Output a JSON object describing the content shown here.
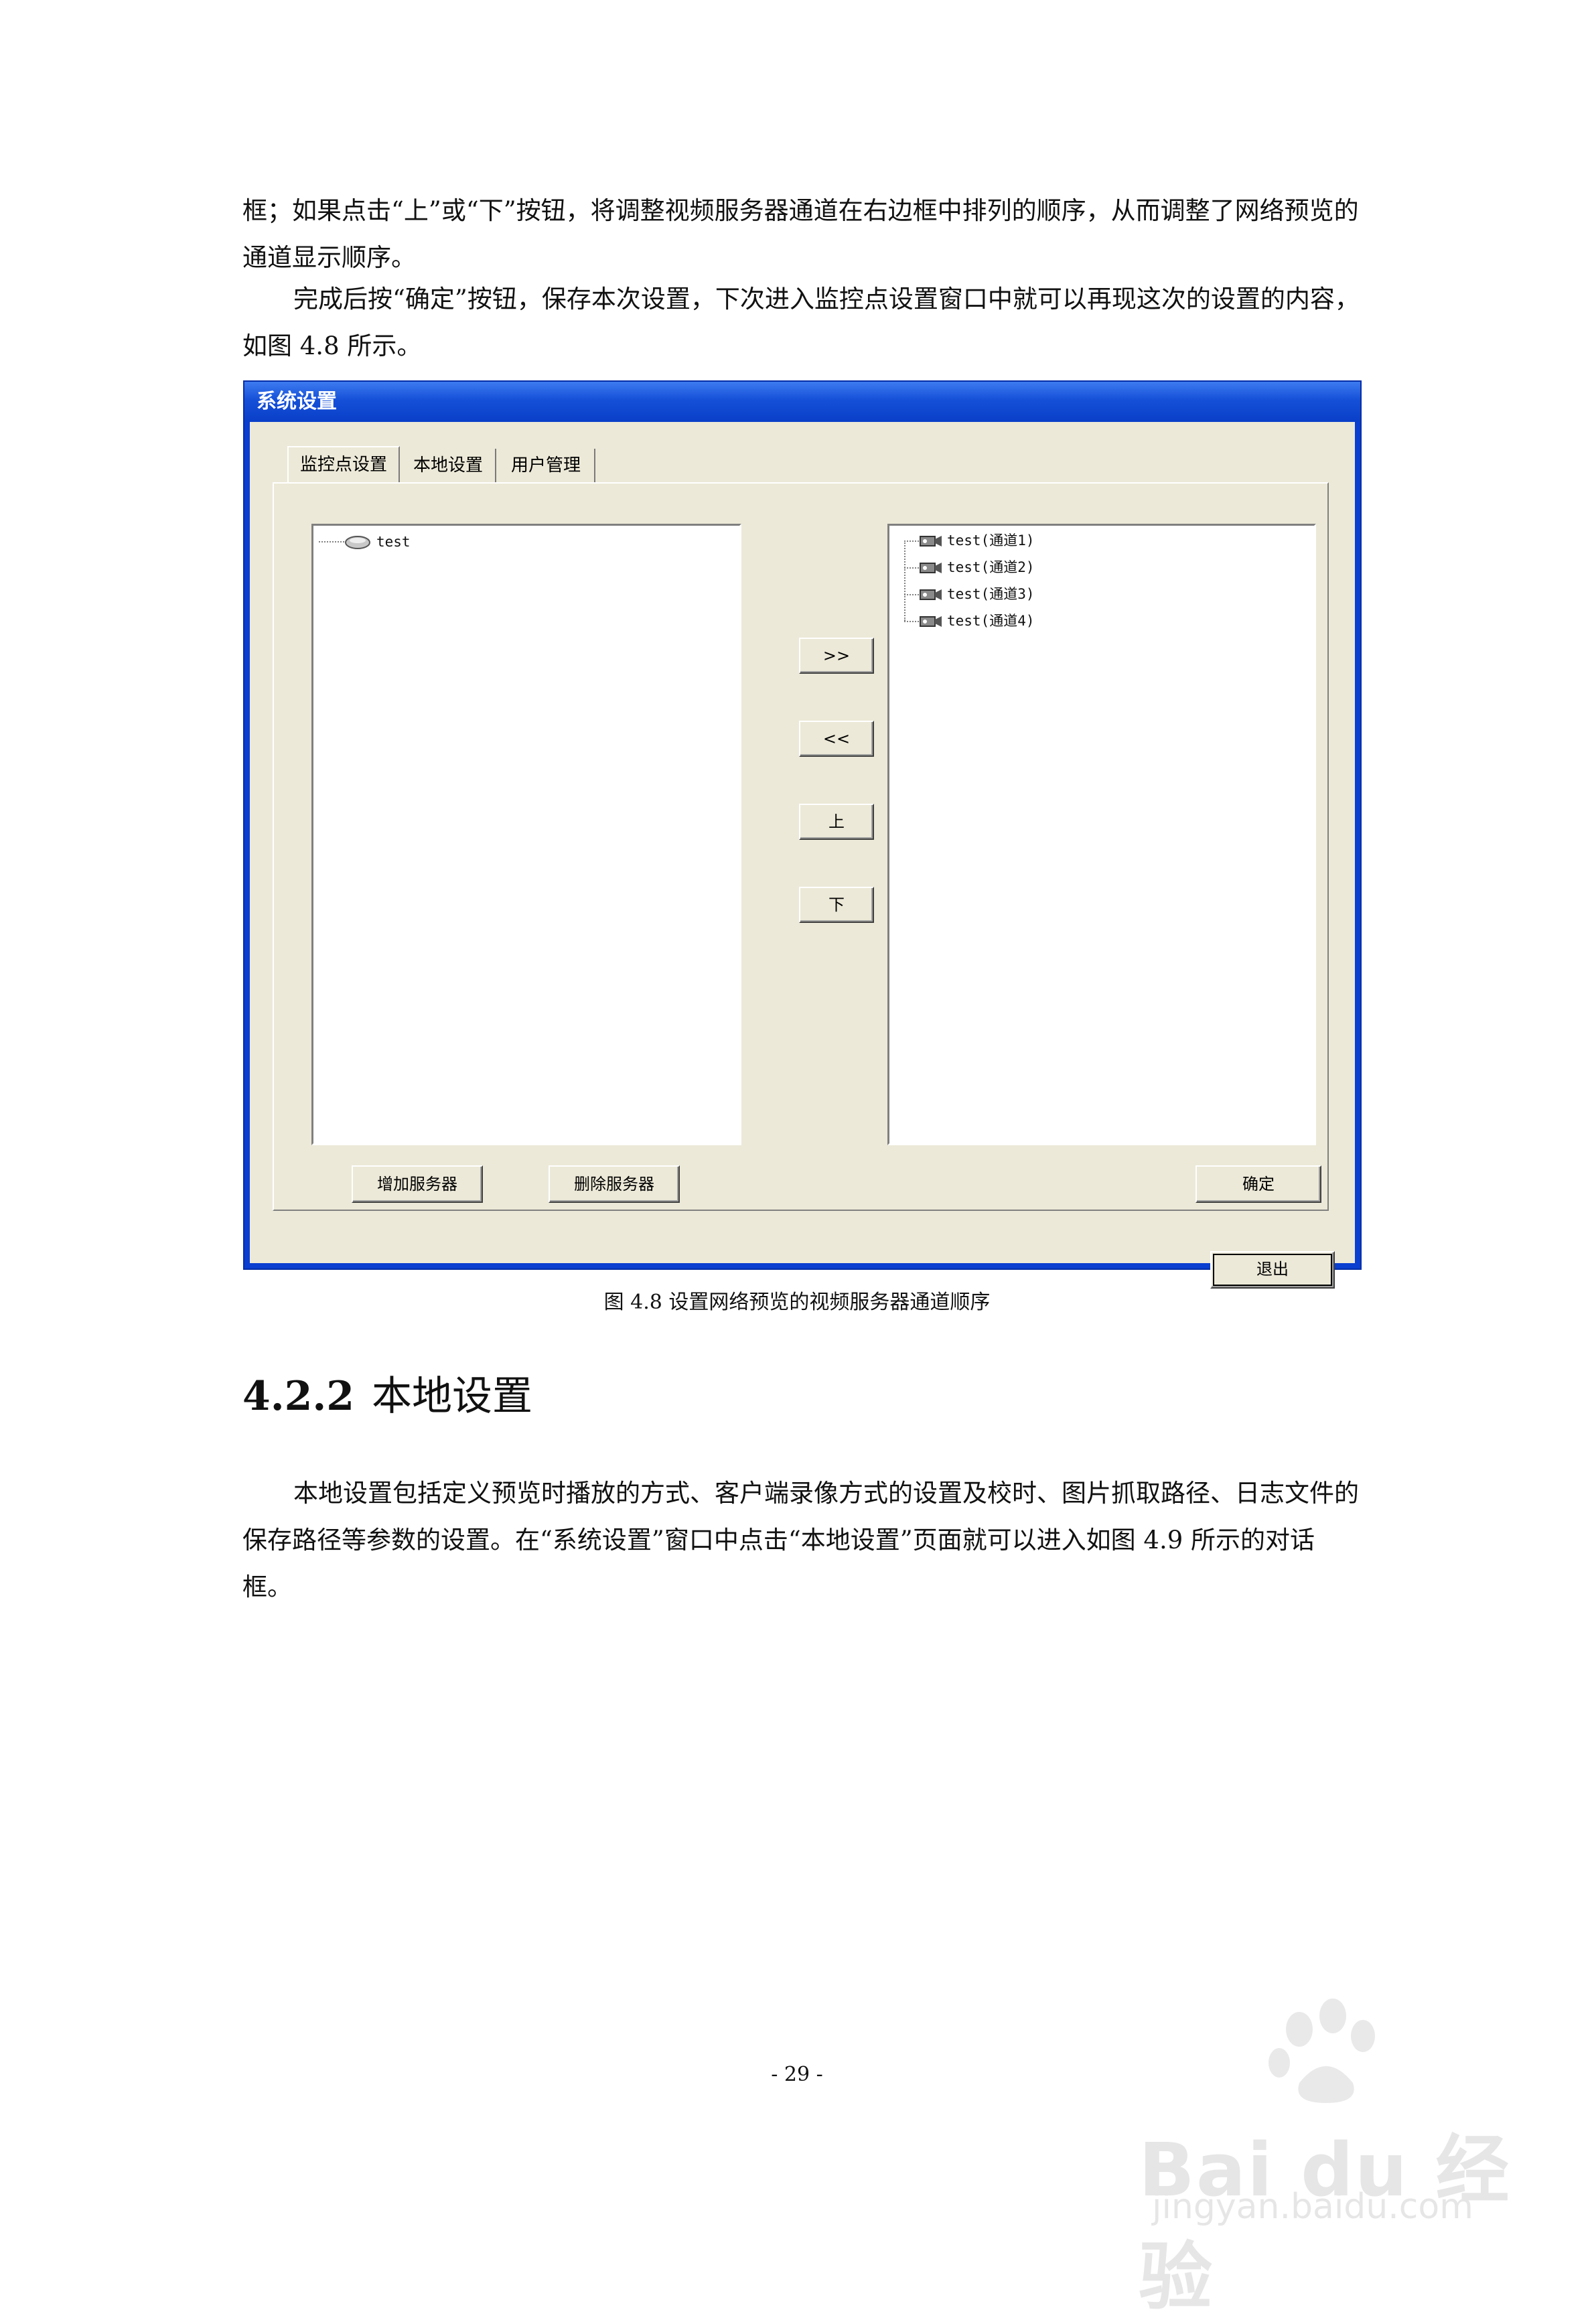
{
  "body": {
    "para1": "框；如果点击“上”或“下”按钮，将调整视频服务器通道在右边框中排列的顺序，从而调整了网络预览的通道显示顺序。",
    "para2": "完成后按“确定”按钮，保存本次设置，下次进入监控点设置窗口中就可以再现这次的设置的内容，如图 4.8 所示。",
    "para3": "本地设置包括定义预览时播放的方式、客户端录像方式的设置及校时、图片抓取路径、日志文件的保存路径等参数的设置。在“系统设置”窗口中点击“本地设置”页面就可以进入如图 4.9 所示的对话框。"
  },
  "dialog": {
    "title": "系统设置",
    "tabs": [
      {
        "label": "监控点设置",
        "active": true
      },
      {
        "label": "本地设置",
        "active": false
      },
      {
        "label": "用户管理",
        "active": false
      }
    ],
    "left_tree": [
      {
        "label": "test",
        "icon": "server-icon"
      }
    ],
    "right_tree": [
      {
        "label": "test(通道1)",
        "icon": "camera-icon"
      },
      {
        "label": "test(通道2)",
        "icon": "camera-icon"
      },
      {
        "label": "test(通道3)",
        "icon": "camera-icon"
      },
      {
        "label": "test(通道4)",
        "icon": "camera-icon"
      }
    ],
    "buttons": {
      "add_all": ">>",
      "remove_all": "<<",
      "up": "上",
      "down": "下",
      "add_server": "增加服务器",
      "delete_server": "删除服务器",
      "confirm": "确定",
      "exit": "退出"
    }
  },
  "caption": "图 4.8  设置网络预览的视频服务器通道顺序",
  "heading": {
    "number": "4.2.2",
    "title": "本地设置"
  },
  "page_number": "- 29 -",
  "watermark": {
    "brand": "Bai du 经验",
    "url": "jingyan.baidu.com"
  }
}
